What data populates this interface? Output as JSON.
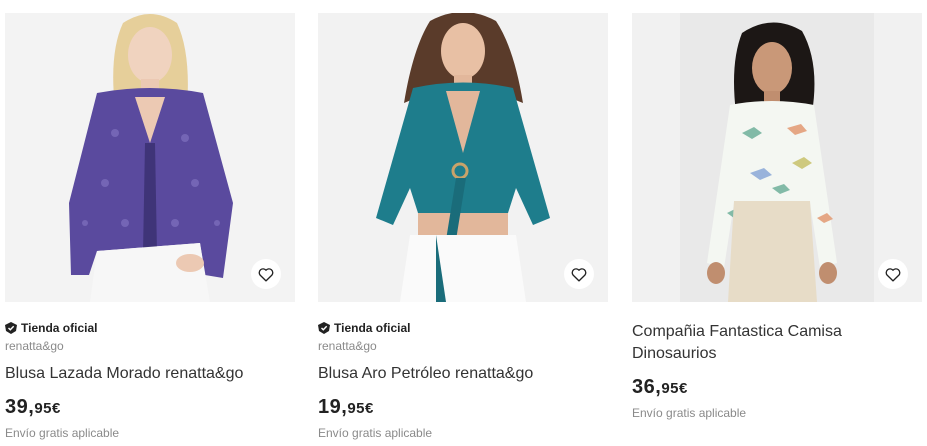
{
  "products": [
    {
      "official_store": "Tienda oficial",
      "seller": "renatta&go",
      "title": "Blusa Lazada Morado renatta&go",
      "price_int": "39,",
      "price_dec": "95€",
      "shipping": "Envío gratis aplicable",
      "image_icon": "purple-blouse-photo"
    },
    {
      "official_store": "Tienda oficial",
      "seller": "renatta&go",
      "title": "Blusa Aro Petróleo renatta&go",
      "price_int": "19,",
      "price_dec": "95€",
      "shipping": "Envío gratis aplicable",
      "image_icon": "teal-blouse-photo"
    },
    {
      "title": "Compañia Fantastica Camisa Dinosaurios",
      "price_int": "36,",
      "price_dec": "95€",
      "shipping": "Envío gratis aplicable",
      "image_icon": "dinosaur-shirt-photo"
    }
  ],
  "icons": {
    "favorite": "heart-icon",
    "official": "verified-badge-icon"
  },
  "colors": {
    "purple": "#5a4a9e",
    "teal": "#1e7d8c",
    "text": "#222222",
    "muted": "#8a8a8a"
  }
}
